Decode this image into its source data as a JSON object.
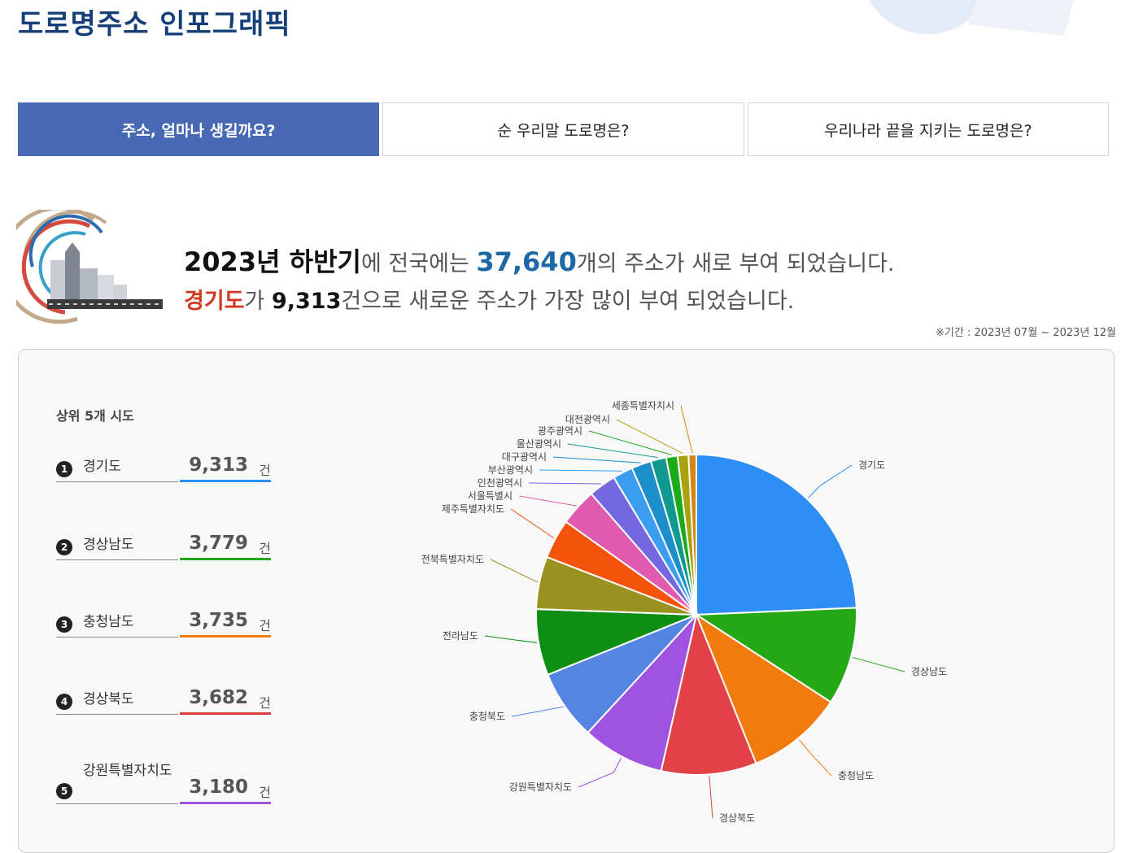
{
  "page": {
    "title": "도로명주소 인포그래픽"
  },
  "tabs": [
    {
      "label": "주소, 얼마나 생길까요?",
      "active": true
    },
    {
      "label": "순 우리말 도로명은?",
      "active": false
    },
    {
      "label": "우리나라 끝을 지키는 도로명은?",
      "active": false
    }
  ],
  "summary": {
    "line1": {
      "period": "2023년 하반기",
      "mid": "에 전국에는 ",
      "count": "37,640",
      "end": "개의 주소가 새로 부여 되었습니다."
    },
    "line2": {
      "region": "경기도",
      "mid": "가 ",
      "count": "9,313",
      "end": "건으로 새로운 주소가 가장 많이 부여 되었습니다."
    },
    "period_note": "※기간 : 2023년 07월 ~ 2023년 12월"
  },
  "top5": {
    "title": "상위 5개 시도",
    "unit": "건",
    "items": [
      {
        "rank": "1",
        "name": "경기도",
        "value": "9,313",
        "color": "#2d8ff5"
      },
      {
        "rank": "2",
        "name": "경상남도",
        "value": "3,779",
        "color": "#25a815"
      },
      {
        "rank": "3",
        "name": "충청남도",
        "value": "3,735",
        "color": "#f27b0d"
      },
      {
        "rank": "4",
        "name": "경상북도",
        "value": "3,682",
        "color": "#d84040"
      },
      {
        "rank": "5",
        "name": "강원특별자치도",
        "value": "3,180",
        "color": "#9e55dd"
      }
    ]
  },
  "chart_data": {
    "type": "pie",
    "categories": [
      "경기도",
      "경상남도",
      "충청남도",
      "경상북도",
      "강원특별자치도",
      "충청북도",
      "전라남도",
      "전북특별자치도",
      "제주특별자치도",
      "서울특별시",
      "인천광역시",
      "부산광역시",
      "대구광역시",
      "울산광역시",
      "광주광역시",
      "대전광역시",
      "세종특별자치시"
    ],
    "values": [
      9313,
      3779,
      3735,
      3682,
      3180,
      2700,
      2560,
      2030,
      1530,
      1440,
      1060,
      780,
      760,
      600,
      440,
      420,
      300
    ],
    "colors": [
      "#2d8ff5",
      "#25a815",
      "#f27b0d",
      "#e24145",
      "#a052e0",
      "#5585e3",
      "#0e8f14",
      "#9a9120",
      "#f5520c",
      "#e05ab0",
      "#7467e0",
      "#3a9df0",
      "#1c8ec9",
      "#10998f",
      "#1aaa1a",
      "#a8a30d",
      "#d4860f"
    ]
  }
}
